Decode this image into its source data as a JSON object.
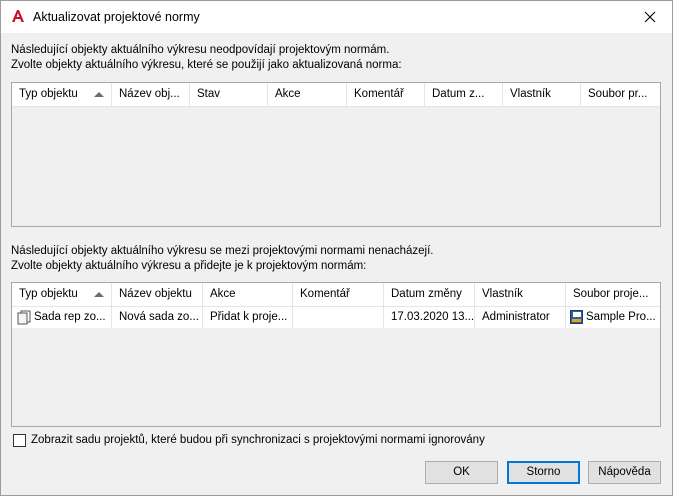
{
  "window": {
    "title": "Aktualizovat projektové normy"
  },
  "top_section": {
    "line1": "Následující objekty aktuálního výkresu neodpovídají projektovým normám.",
    "line2": "Zvolte objekty aktuálního výkresu, které se použijí jako aktualizovaná norma:",
    "columns": [
      "Typ objektu",
      "Název obj...",
      "Stav",
      "Akce",
      "Komentář",
      "Datum z...",
      "Vlastník",
      "Soubor pr..."
    ],
    "rows": []
  },
  "bottom_section": {
    "line1": "Následující objekty aktuálního výkresu se mezi projektovými normami nenacházejí.",
    "line2": "Zvolte objekty aktuálního výkresu a přidejte je k projektovým normám:",
    "columns": [
      "Typ objektu",
      "Název objektu",
      "Akce",
      "Komentář",
      "Datum změny",
      "Vlastník",
      "Soubor proje..."
    ],
    "rows": [
      [
        "Sada rep zo...",
        "Nová sada zo...",
        "Přidat k proje...",
        "",
        "17.03.2020 13....",
        "Administrator",
        "Sample Pro..."
      ]
    ]
  },
  "checkbox": {
    "label": "Zobrazit sadu projektů, které budou při synchronizaci s projektovými normami ignorovány",
    "checked": false
  },
  "buttons": {
    "ok": "OK",
    "cancel": "Storno",
    "help": "Nápověda"
  },
  "colors": {
    "accent": "#0078d7",
    "app_icon": "#c8102e"
  },
  "icons": {
    "app": "autocad-a-icon",
    "row_type": "layer-state-icon",
    "project_file": "project-file-icon"
  }
}
